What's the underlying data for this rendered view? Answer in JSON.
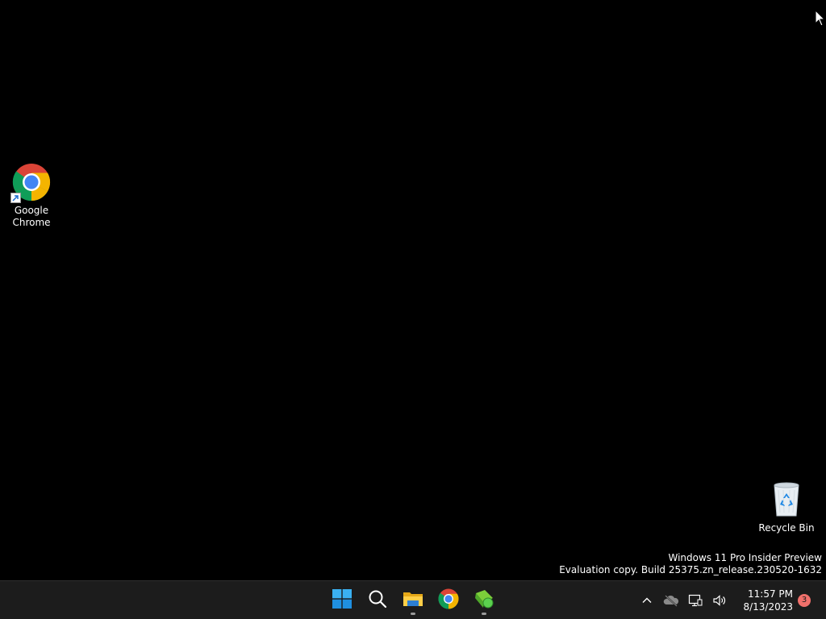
{
  "desktop": {
    "icons": [
      {
        "label": "Google Chrome",
        "icon": "chrome-icon",
        "shortcut": true
      },
      {
        "label": "Recycle Bin",
        "icon": "recycle-bin-icon",
        "shortcut": false
      }
    ],
    "watermark": {
      "line1": "Windows 11 Pro Insider Preview",
      "line2": "Evaluation copy. Build 25375.zn_release.230520-1632"
    },
    "background_color": "#000000"
  },
  "taskbar": {
    "apps": [
      {
        "name": "Start",
        "icon": "windows-start-icon",
        "running": false
      },
      {
        "name": "Search",
        "icon": "search-icon",
        "running": false
      },
      {
        "name": "File Explorer",
        "icon": "folder-icon",
        "running": true
      },
      {
        "name": "Google Chrome",
        "icon": "chrome-icon",
        "running": false
      },
      {
        "name": "App",
        "icon": "green-app-icon",
        "running": true
      }
    ],
    "tray": {
      "icons": [
        "chevron-up-icon",
        "onedrive-offline-icon",
        "network-icon",
        "volume-icon"
      ],
      "time": "11:57 PM",
      "date": "8/13/2023",
      "notification_count": "3"
    },
    "background_color": "#1c1c1c",
    "accent": "#0078d4"
  }
}
